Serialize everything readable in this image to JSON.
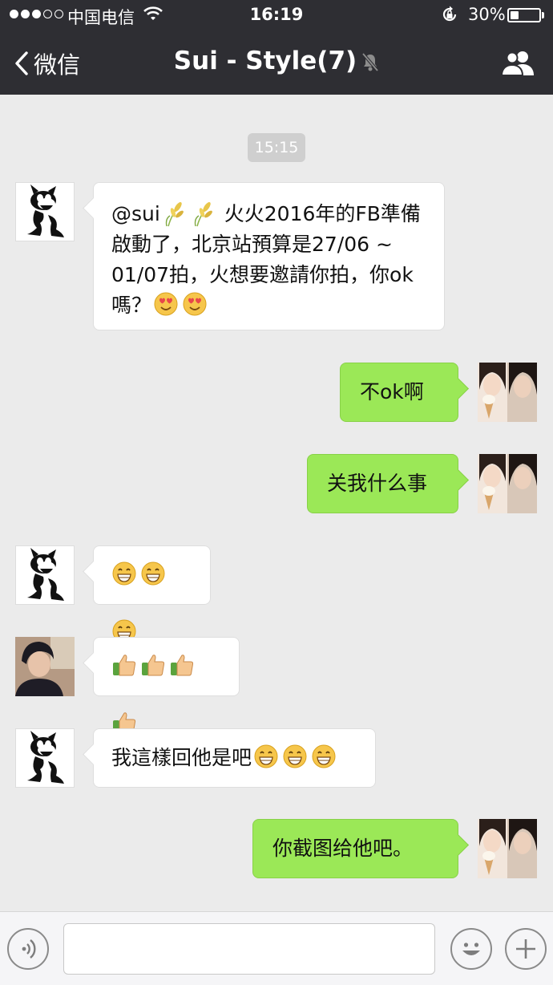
{
  "status_bar": {
    "carrier": "中国电信",
    "time": "16:19",
    "battery_percent": "30%",
    "battery_level": 0.3
  },
  "nav": {
    "back_label": "微信",
    "title": "Sui - Style(7)"
  },
  "chat": {
    "timestamp": "15:15",
    "messages": [
      {
        "side": "in",
        "avatar": "felix-cartoon-avatar",
        "segments": [
          {
            "t": "text",
            "v": "@sui"
          },
          {
            "t": "icon",
            "v": "wheat-icon"
          },
          {
            "t": "icon",
            "v": "wheat-icon"
          },
          {
            "t": "text",
            "v": " 火火2016年的FB準備啟動了，北京站預算是27/06 ~ 01/07拍，火想要邀請你拍，你ok嗎？"
          },
          {
            "t": "icon",
            "v": "heart-eyes-emoji"
          },
          {
            "t": "icon",
            "v": "heart-eyes-emoji"
          }
        ]
      },
      {
        "side": "out",
        "avatar": "girl-photo-avatar",
        "segments": [
          {
            "t": "text",
            "v": "不ok啊"
          }
        ]
      },
      {
        "side": "out",
        "avatar": "girl-photo-avatar",
        "segments": [
          {
            "t": "text",
            "v": "关我什么事"
          }
        ]
      },
      {
        "side": "in",
        "avatar": "felix-cartoon-avatar",
        "segments": [
          {
            "t": "icon",
            "v": "grin-emoji"
          },
          {
            "t": "icon",
            "v": "grin-emoji"
          },
          {
            "t": "icon",
            "v": "grin-emoji"
          }
        ]
      },
      {
        "side": "in",
        "avatar": "man-photo-avatar",
        "segments": [
          {
            "t": "icon",
            "v": "thumbs-up-emoji"
          },
          {
            "t": "icon",
            "v": "thumbs-up-emoji"
          },
          {
            "t": "icon",
            "v": "thumbs-up-emoji"
          },
          {
            "t": "icon",
            "v": "thumbs-up-emoji"
          }
        ]
      },
      {
        "side": "in",
        "avatar": "felix-cartoon-avatar",
        "segments": [
          {
            "t": "text",
            "v": "我這樣回他是吧"
          },
          {
            "t": "icon",
            "v": "grin-emoji"
          },
          {
            "t": "icon",
            "v": "grin-emoji"
          },
          {
            "t": "icon",
            "v": "grin-emoji"
          }
        ]
      },
      {
        "side": "out",
        "avatar": "girl-photo-avatar",
        "segments": [
          {
            "t": "text",
            "v": "你截图给他吧。"
          }
        ]
      }
    ]
  },
  "input_bar": {
    "voice_icon": "voice-icon",
    "emoji_icon": "smiley-icon",
    "more_icon": "plus-icon",
    "text_value": ""
  },
  "colors": {
    "nav_bg": "#2e2e33",
    "chat_bg": "#ebebeb",
    "out_bubble": "#9be857",
    "in_bubble": "#ffffff"
  }
}
